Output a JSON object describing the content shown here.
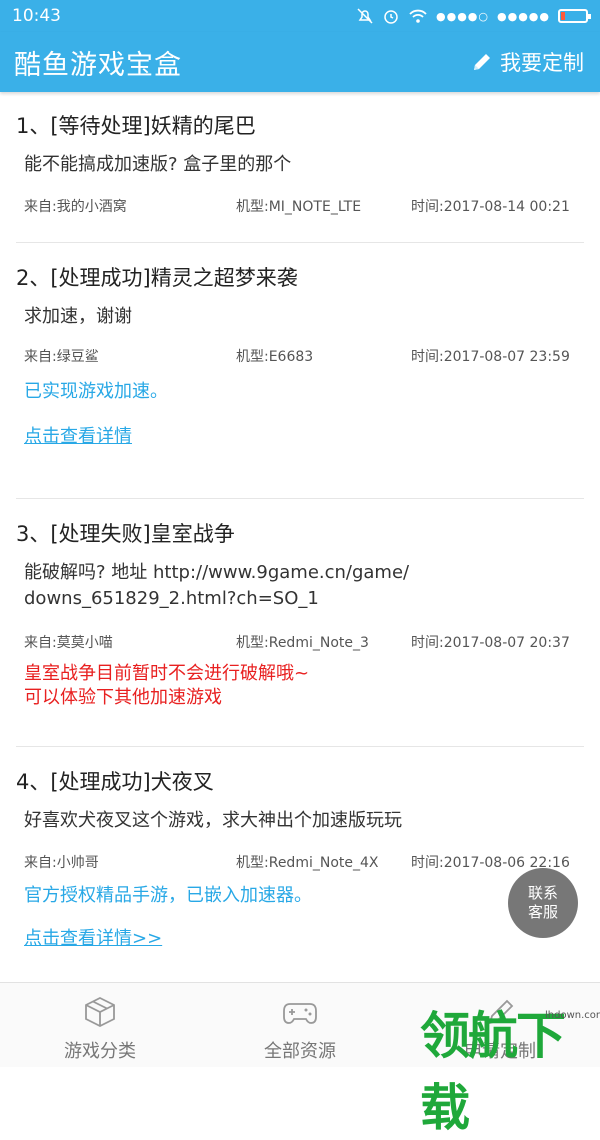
{
  "status": {
    "time": "10:43"
  },
  "appbar": {
    "title": "酷鱼游戏宝盒",
    "custom_label": "我要定制"
  },
  "items": [
    {
      "title": "1、[等待处理]妖精的尾巴",
      "body": "能不能搞成加速版? 盒子里的那个",
      "from": "来自:我的小酒窝",
      "model": "机型:MI_NOTE_LTE",
      "time": "时间:2017-08-14 00:21"
    },
    {
      "title": "2、[处理成功]精灵之超梦来袭",
      "body": "求加速，谢谢",
      "from": "来自:绿豆鲨",
      "model": "机型:E6683",
      "time": "时间:2017-08-07 23:59",
      "reply": "已实现游戏加速。",
      "link": "点击查看详情"
    },
    {
      "title": "3、[处理失败]皇室战争",
      "body_lines": [
        "能破解吗? 地址 http://www.9game.cn/game/",
        "downs_651829_2.html?ch=SO_1"
      ],
      "from": "来自:莫莫小喵",
      "model": "机型:Redmi_Note_3",
      "time": "时间:2017-08-07 20:37",
      "reply_lines": [
        "皇室战争目前暂时不会进行破解哦~",
        "可以体验下其他加速游戏"
      ]
    },
    {
      "title": "4、[处理成功]犬夜叉",
      "body": "好喜欢犬夜叉这个游戏，求大神出个加速版玩玩",
      "from": "来自:小帅哥",
      "model": "机型:Redmi_Note_4X",
      "time": "时间:2017-08-06 22:16",
      "reply": "官方授权精品手游，已嵌入加速器。",
      "link": "点击查看详情>>"
    }
  ],
  "float_service": {
    "line1": "联系",
    "line2": "客服"
  },
  "tabs": [
    {
      "label": "游戏分类",
      "icon": "box-icon"
    },
    {
      "label": "全部资源",
      "icon": "gamepad-icon"
    },
    {
      "label": "申请定制",
      "icon": "pencil-icon"
    }
  ],
  "watermark": {
    "text": "领航下载",
    "site": "lhdown.com"
  },
  "colors": {
    "primary": "#3ab0e8",
    "link": "#28a8e6",
    "error": "#e82020",
    "watermark": "#1fa83a"
  }
}
